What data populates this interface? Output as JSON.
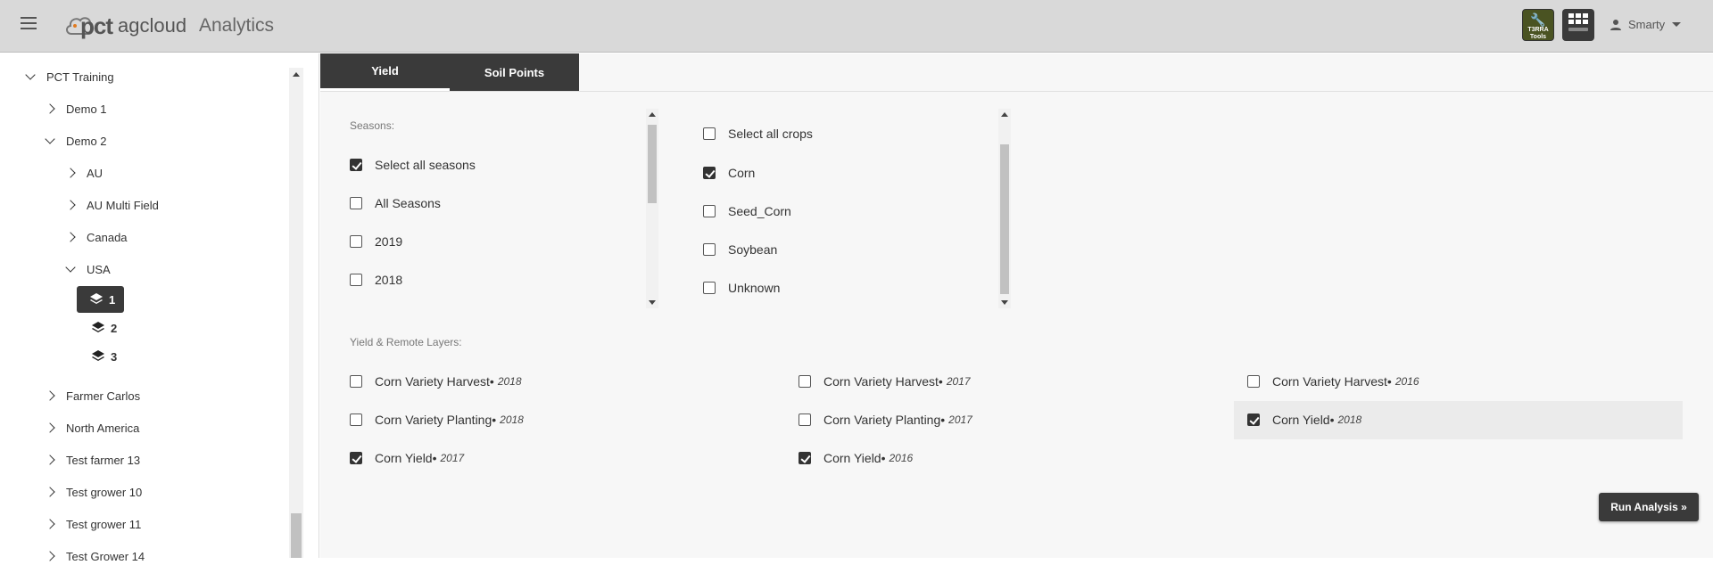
{
  "header": {
    "logo_pct": "pct",
    "logo_ag": "agcloud",
    "app_title": "Analytics",
    "terra_label": "T3RRA",
    "terra_sub": "Tools",
    "user_name": "Smarty",
    "icons": [
      "menu-icon",
      "wrench-icon",
      "apps-grid-icon",
      "person-icon",
      "caret-down-icon"
    ]
  },
  "sidebar": {
    "items": [
      {
        "label": "PCT Training"
      },
      {
        "label": "Demo 1"
      },
      {
        "label": "Demo 2"
      },
      {
        "label": "AU"
      },
      {
        "label": "AU Multi Field"
      },
      {
        "label": "Canada"
      },
      {
        "label": "USA"
      },
      {
        "label": "1"
      },
      {
        "label": "2"
      },
      {
        "label": "3"
      },
      {
        "label": "Farmer Carlos"
      },
      {
        "label": "North America"
      },
      {
        "label": "Test farmer 13"
      },
      {
        "label": "Test grower 10"
      },
      {
        "label": "Test grower 11"
      },
      {
        "label": "Test Grower 14"
      }
    ]
  },
  "tabs": [
    {
      "label": "Yield",
      "active": true
    },
    {
      "label": "Soil Points",
      "active": false
    }
  ],
  "seasons": {
    "label": "Seasons:",
    "items": [
      {
        "label": "Select all seasons",
        "checked": true
      },
      {
        "label": "All Seasons",
        "checked": false
      },
      {
        "label": "2019",
        "checked": false
      },
      {
        "label": "2018",
        "checked": false
      }
    ]
  },
  "crops": {
    "items": [
      {
        "label": "Select all crops",
        "checked": false
      },
      {
        "label": "Corn",
        "checked": true
      },
      {
        "label": "Seed_Corn",
        "checked": false
      },
      {
        "label": "Soybean",
        "checked": false
      },
      {
        "label": "Unknown",
        "checked": false
      }
    ]
  },
  "layers": {
    "label": "Yield & Remote Layers:",
    "items": [
      {
        "name": "Corn Variety Harvest",
        "sep": " •",
        "year": "2018",
        "checked": false
      },
      {
        "name": "Corn Variety Harvest",
        "sep": " •",
        "year": "2017",
        "checked": false
      },
      {
        "name": "Corn Variety Harvest",
        "sep": " •",
        "year": "2016",
        "checked": false
      },
      {
        "name": "Corn Variety Planting",
        "sep": " •",
        "year": "2018",
        "checked": false
      },
      {
        "name": "Corn Variety Planting",
        "sep": " •",
        "year": "2017",
        "checked": false
      },
      {
        "name": "Corn Yield",
        "sep": " •",
        "year": "2018",
        "checked": true
      },
      {
        "name": "Corn Yield",
        "sep": " •",
        "year": "2017",
        "checked": true
      },
      {
        "name": "Corn Yield",
        "sep": " •",
        "year": "2016",
        "checked": true
      }
    ]
  },
  "run_button": "Run Analysis »",
  "colors": {
    "header_bg": "#d9d9d9",
    "dark": "#3a3a3a",
    "terra_green": "#4a5322"
  }
}
